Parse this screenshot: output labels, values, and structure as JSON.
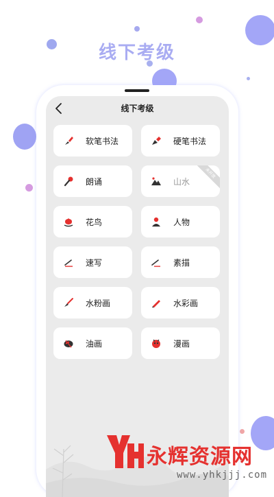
{
  "banner": {
    "title": "线下考级"
  },
  "screen": {
    "title": "线下考级"
  },
  "items": [
    {
      "label": "软笔书法",
      "icon": "brush-pen-icon",
      "disabled": false
    },
    {
      "label": "硬笔书法",
      "icon": "fountain-pen-icon",
      "disabled": false
    },
    {
      "label": "朗诵",
      "icon": "microphone-icon",
      "disabled": false
    },
    {
      "label": "山水",
      "icon": "mountain-icon",
      "disabled": true,
      "badge": "未开放"
    },
    {
      "label": "花鸟",
      "icon": "flower-icon",
      "disabled": false
    },
    {
      "label": "人物",
      "icon": "person-icon",
      "disabled": false
    },
    {
      "label": "速写",
      "icon": "sketch-pen-icon",
      "disabled": false
    },
    {
      "label": "素描",
      "icon": "pencil-line-icon",
      "disabled": false
    },
    {
      "label": "水粉画",
      "icon": "paint-brush-icon",
      "disabled": false
    },
    {
      "label": "水彩画",
      "icon": "pencil-icon",
      "disabled": false
    },
    {
      "label": "油画",
      "icon": "palette-icon",
      "disabled": false
    },
    {
      "label": "漫画",
      "icon": "cartoon-face-icon",
      "disabled": false
    }
  ],
  "watermark": {
    "brand": "永辉资源网",
    "url": "www.yhkjjj.com"
  },
  "colors": {
    "accent": "#a9acf2",
    "icon_red": "#e5312f",
    "icon_dark": "#333333",
    "screen_bg": "#ebebeb"
  }
}
